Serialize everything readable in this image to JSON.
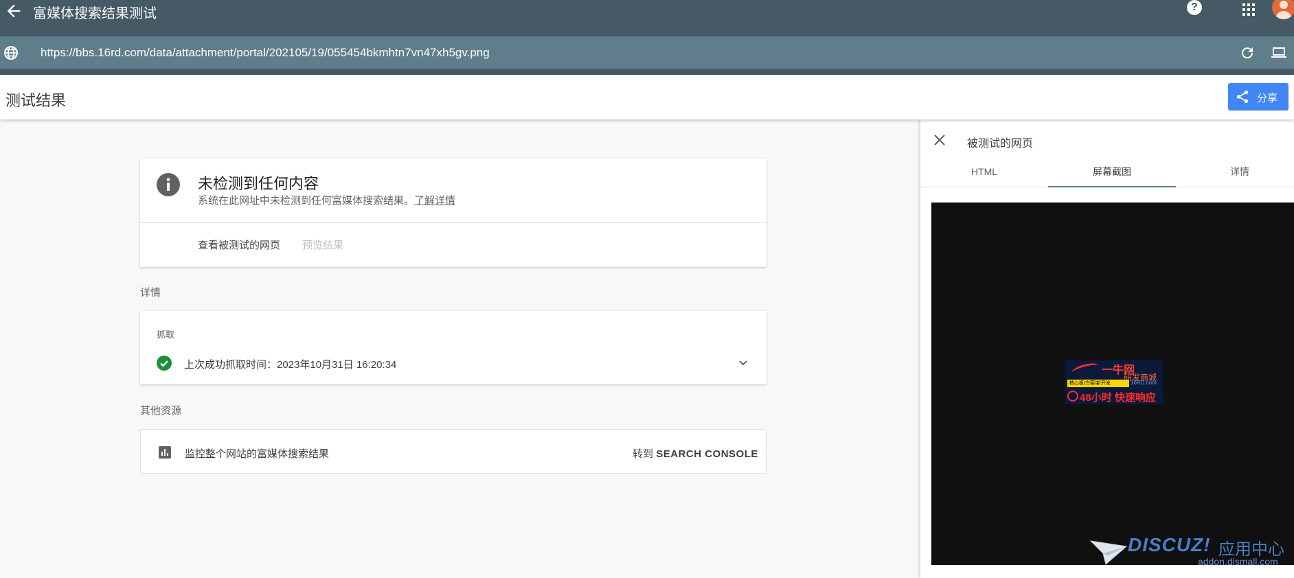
{
  "topbar": {
    "title": "富媒体搜索结果测试",
    "help_label": "?"
  },
  "urlbar": {
    "url": "https://bbs.16rd.com/data/attachment/portal/202105/19/055454bkmhtn7vn47xh5gv.png"
  },
  "header": {
    "page_title": "测试结果",
    "share_label": "分享",
    "share_color": "#4285f4"
  },
  "result_card": {
    "heading": "未检测到任何内容",
    "description": "系统在此网址中未检测到任何富媒体搜索结果。",
    "learn_more": "了解详情",
    "view_page": "查看被测试的网页",
    "preview": "预览结果"
  },
  "details": {
    "section_label": "详情",
    "crawl_label": "抓取",
    "crawl_text": "上次成功抓取时间：2023年10月31日 16:20:34",
    "status_color": "#1e8e3e"
  },
  "resources": {
    "section_label": "其他资源",
    "monitor_text": "监控整个网站的富媒体搜索结果",
    "goto_prefix": "转到",
    "goto_target": "SEARCH CONSOLE"
  },
  "panel": {
    "title": "被测试的网页",
    "tabs": [
      {
        "label": "HTML",
        "active": false
      },
      {
        "label": "屏幕截图",
        "active": true
      },
      {
        "label": "详情",
        "active": false
      }
    ],
    "screenshot_ad": {
      "line1": "一牛网",
      "line2": "研发商城",
      "line3": "核心板/方案/新开发",
      "line4": "16RD.com",
      "line5": "48小时 快速响应"
    }
  },
  "watermark": {
    "brand": "DISCUZ!",
    "center": "应用中心",
    "domain": "addon.dismall.com"
  },
  "colors": {
    "topbar": "#455a64",
    "urlbar": "#607d8b",
    "accent": "#4285f4"
  }
}
